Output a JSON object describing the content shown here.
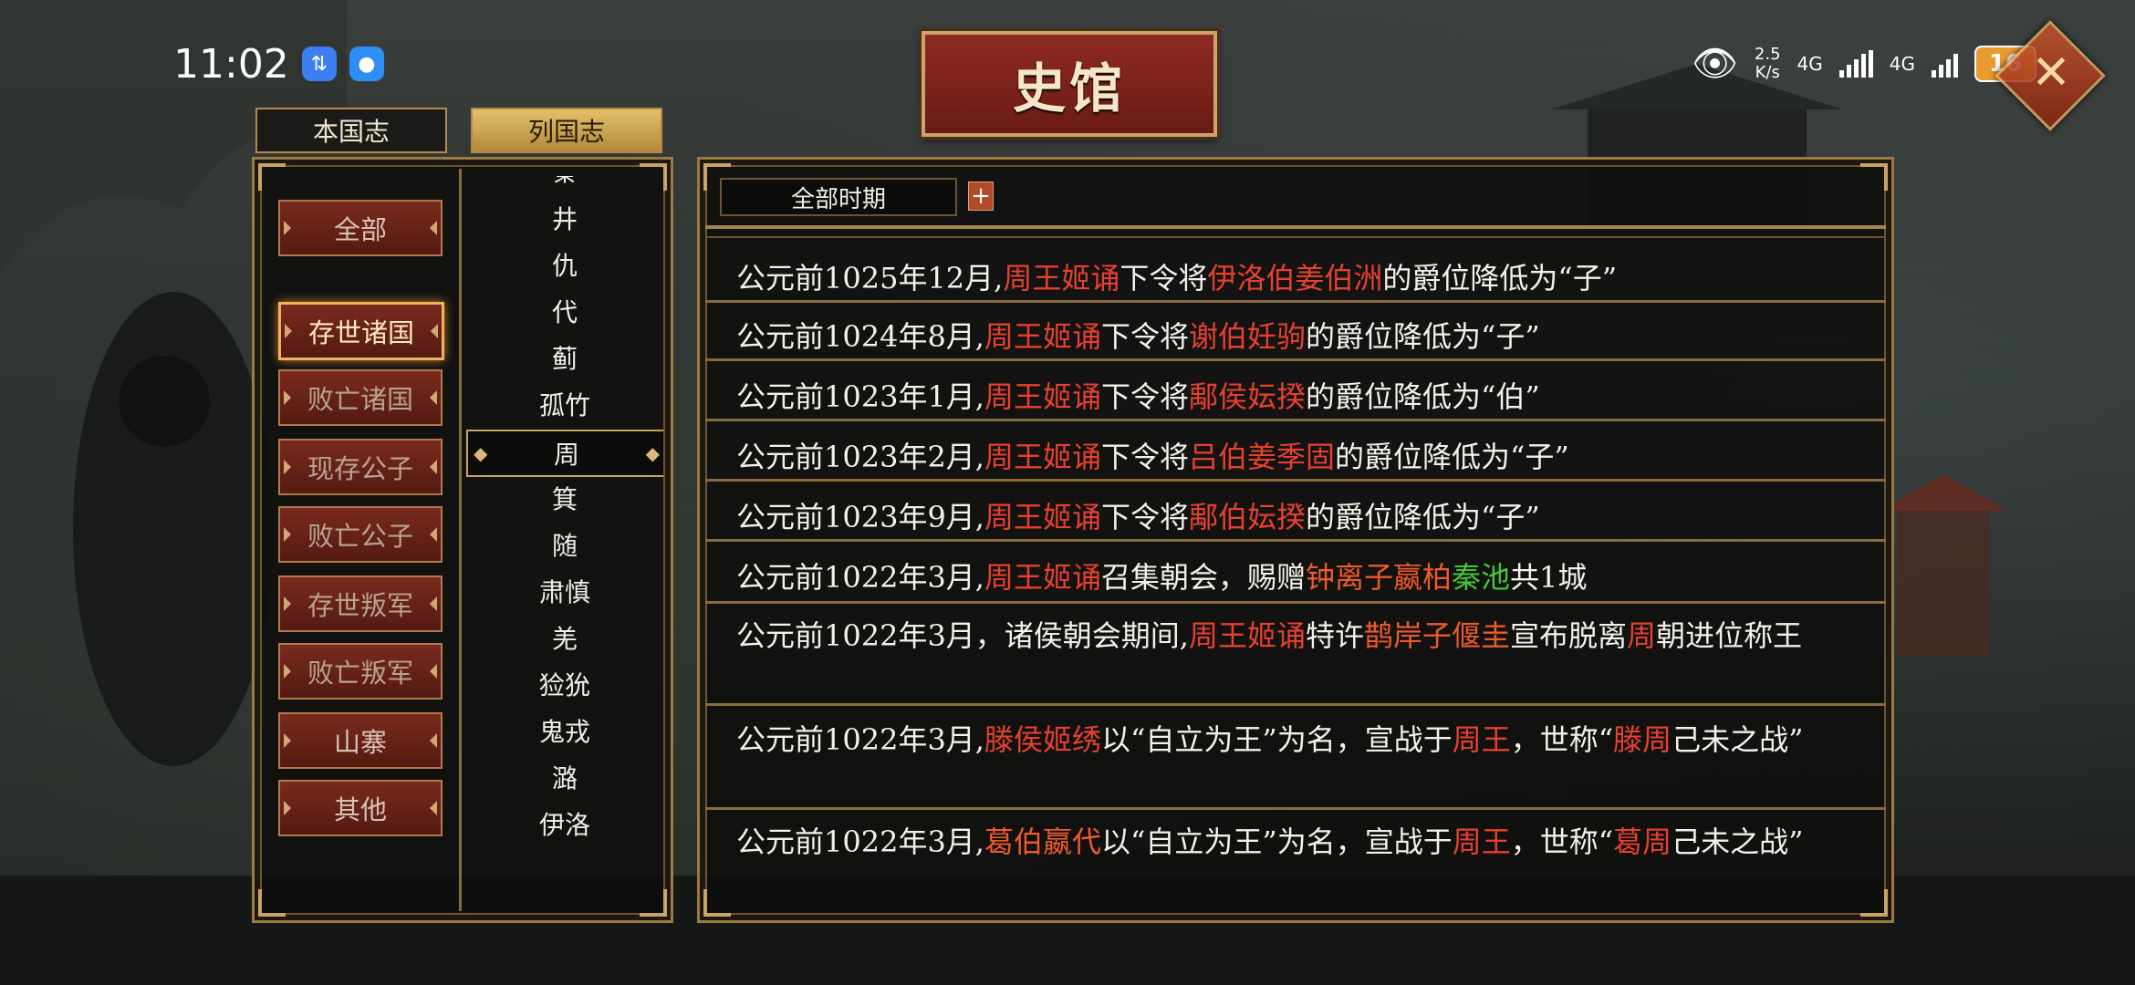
{
  "status_bar": {
    "time": "11:02",
    "net_speed_value": "2.5",
    "net_speed_unit": "K/s",
    "sim1": "4G",
    "sim2": "4G",
    "battery": "16"
  },
  "title": "史馆",
  "tabs": {
    "own": "本国志",
    "others": "列国志"
  },
  "categories": [
    "全部",
    "存世诸国",
    "败亡诸国",
    "现存公子",
    "败亡公子",
    "存世叛军",
    "败亡叛军",
    "山寨",
    "其他"
  ],
  "selected_category": "存世诸国",
  "nations": [
    "秦",
    "井",
    "仇",
    "代",
    "蓟",
    "孤竹",
    "周",
    "箕",
    "随",
    "肃慎",
    "羌",
    "猃狁",
    "鬼戎",
    "潞",
    "伊洛"
  ],
  "selected_nation": "周",
  "period_filter": "全部时期",
  "period_add": "+",
  "records": [
    {
      "segments": [
        {
          "t": "公元前1025年12月,"
        },
        {
          "t": "周王姬诵",
          "c": "red"
        },
        {
          "t": "下令将"
        },
        {
          "t": "伊洛伯姜伯洲",
          "c": "red"
        },
        {
          "t": "的爵位降低为“子”"
        }
      ]
    },
    {
      "segments": [
        {
          "t": "公元前1024年8月,"
        },
        {
          "t": "周王姬诵",
          "c": "red"
        },
        {
          "t": "下令将"
        },
        {
          "t": "谢伯妊驹",
          "c": "red"
        },
        {
          "t": "的爵位降低为“子”"
        }
      ]
    },
    {
      "segments": [
        {
          "t": "公元前1023年1月,"
        },
        {
          "t": "周王姬诵",
          "c": "red"
        },
        {
          "t": "下令将"
        },
        {
          "t": "鄅侯妘揆",
          "c": "red"
        },
        {
          "t": "的爵位降低为“伯”"
        }
      ]
    },
    {
      "segments": [
        {
          "t": "公元前1023年2月,"
        },
        {
          "t": "周王姬诵",
          "c": "red"
        },
        {
          "t": "下令将"
        },
        {
          "t": "吕伯姜季固",
          "c": "red"
        },
        {
          "t": "的爵位降低为“子”"
        }
      ]
    },
    {
      "segments": [
        {
          "t": "公元前1023年9月,"
        },
        {
          "t": "周王姬诵",
          "c": "red"
        },
        {
          "t": "下令将"
        },
        {
          "t": "鄅伯妘揆",
          "c": "red"
        },
        {
          "t": "的爵位降低为“子”"
        }
      ]
    },
    {
      "segments": [
        {
          "t": "公元前1022年3月,"
        },
        {
          "t": "周王姬诵",
          "c": "red"
        },
        {
          "t": "召集朝会，赐赠"
        },
        {
          "t": "钟离子嬴柏",
          "c": "orange"
        },
        {
          "t": "秦池",
          "c": "green"
        },
        {
          "t": "共1城"
        }
      ]
    },
    {
      "segments": [
        {
          "t": "公元前1022年3月，诸侯朝会期间,"
        },
        {
          "t": "周王姬诵",
          "c": "red"
        },
        {
          "t": "特许"
        },
        {
          "t": "鹊岸子偃圭",
          "c": "orange"
        },
        {
          "t": "宣布脱离"
        },
        {
          "t": "周",
          "c": "red"
        },
        {
          "t": "朝进位称王"
        }
      ]
    },
    {
      "segments": [
        {
          "t": "公元前1022年3月,"
        },
        {
          "t": "滕侯姬绣",
          "c": "red"
        },
        {
          "t": "以“自立为王”为名，宣战于"
        },
        {
          "t": "周王",
          "c": "red"
        },
        {
          "t": "，世称“"
        },
        {
          "t": "滕周",
          "c": "red"
        },
        {
          "t": "己未之战”"
        }
      ]
    },
    {
      "segments": [
        {
          "t": "公元前1022年3月,"
        },
        {
          "t": "葛伯嬴代",
          "c": "orange"
        },
        {
          "t": "以“自立为王”为名，宣战于"
        },
        {
          "t": "周王",
          "c": "red"
        },
        {
          "t": "，世称“"
        },
        {
          "t": "葛周",
          "c": "red"
        },
        {
          "t": "己未之战”"
        }
      ]
    }
  ]
}
